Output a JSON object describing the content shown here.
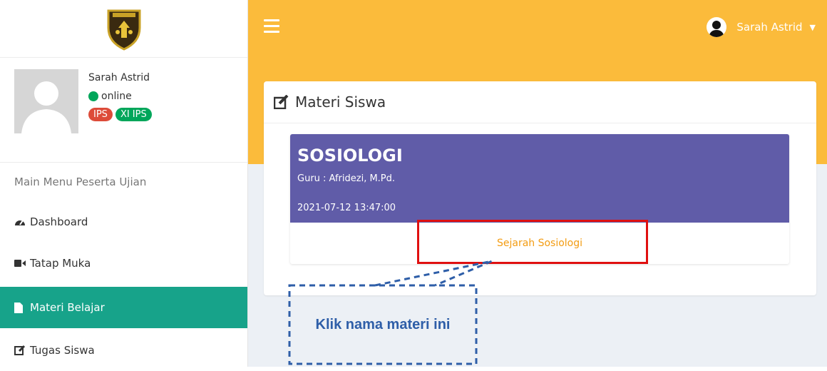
{
  "app": {
    "logo_icon": "school-shield-logo"
  },
  "sidebar": {
    "user": {
      "name": "Sarah Astrid",
      "status": "online",
      "badges": [
        "IPS",
        "XI IPS"
      ]
    },
    "menu_header": "Main Menu Peserta Ujian",
    "items": [
      {
        "label": "Dashboard",
        "icon": "dashboard-icon"
      },
      {
        "label": "Tatap Muka",
        "icon": "video-camera-icon"
      },
      {
        "label": "Materi Belajar",
        "icon": "file-icon"
      },
      {
        "label": "Tugas Siswa",
        "icon": "edit-icon"
      }
    ]
  },
  "topbar": {
    "user_name": "Sarah Astrid"
  },
  "main": {
    "box_title": "Materi Siswa",
    "card": {
      "subject": "SOSIOLOGI",
      "teacher": "Guru : Afridezi, M.Pd.",
      "date": "2021-07-12 13:47:00",
      "material_link": "Sejarah Sosiologi"
    }
  },
  "annotation": {
    "callout_text": "Klik nama materi ini"
  },
  "colors": {
    "topbar": "#fbbb3b",
    "active_menu": "#17a38a",
    "card_header": "#605ca8",
    "link": "#f39c12",
    "highlight": "#e01010",
    "callout": "#2e5ea8"
  }
}
